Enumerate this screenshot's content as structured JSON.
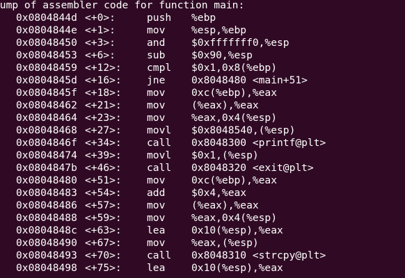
{
  "terminal": {
    "background": "#300a24",
    "foreground": "#ffffff",
    "header": "Dump of assembler code for function main:",
    "lines": [
      {
        "addr": "0x0804844d",
        "off": "<+0>:",
        "mn": "push",
        "ops": "%ebp"
      },
      {
        "addr": "0x0804844e",
        "off": "<+1>:",
        "mn": "mov",
        "ops": "%esp,%ebp"
      },
      {
        "addr": "0x08048450",
        "off": "<+3>:",
        "mn": "and",
        "ops": "$0xfffffff0,%esp"
      },
      {
        "addr": "0x08048453",
        "off": "<+6>:",
        "mn": "sub",
        "ops": "$0x90,%esp"
      },
      {
        "addr": "0x08048459",
        "off": "<+12>:",
        "mn": "cmpl",
        "ops": "$0x1,0x8(%ebp)"
      },
      {
        "addr": "0x0804845d",
        "off": "<+16>:",
        "mn": "jne",
        "ops": "0x8048480 <main+51>"
      },
      {
        "addr": "0x0804845f",
        "off": "<+18>:",
        "mn": "mov",
        "ops": "0xc(%ebp),%eax"
      },
      {
        "addr": "0x08048462",
        "off": "<+21>:",
        "mn": "mov",
        "ops": "(%eax),%eax"
      },
      {
        "addr": "0x08048464",
        "off": "<+23>:",
        "mn": "mov",
        "ops": "%eax,0x4(%esp)"
      },
      {
        "addr": "0x08048468",
        "off": "<+27>:",
        "mn": "movl",
        "ops": "$0x8048540,(%esp)"
      },
      {
        "addr": "0x0804846f",
        "off": "<+34>:",
        "mn": "call",
        "ops": "0x8048300 <printf@plt>"
      },
      {
        "addr": "0x08048474",
        "off": "<+39>:",
        "mn": "movl",
        "ops": "$0x1,(%esp)"
      },
      {
        "addr": "0x0804847b",
        "off": "<+46>:",
        "mn": "call",
        "ops": "0x8048320 <exit@plt>"
      },
      {
        "addr": "0x08048480",
        "off": "<+51>:",
        "mn": "mov",
        "ops": "0xc(%ebp),%eax"
      },
      {
        "addr": "0x08048483",
        "off": "<+54>:",
        "mn": "add",
        "ops": "$0x4,%eax"
      },
      {
        "addr": "0x08048486",
        "off": "<+57>:",
        "mn": "mov",
        "ops": "(%eax),%eax"
      },
      {
        "addr": "0x08048488",
        "off": "<+59>:",
        "mn": "mov",
        "ops": "%eax,0x4(%esp)"
      },
      {
        "addr": "0x0804848c",
        "off": "<+63>:",
        "mn": "lea",
        "ops": "0x10(%esp),%eax"
      },
      {
        "addr": "0x08048490",
        "off": "<+67>:",
        "mn": "mov",
        "ops": "%eax,(%esp)"
      },
      {
        "addr": "0x08048493",
        "off": "<+70>:",
        "mn": "call",
        "ops": "0x8048310 <strcpy@plt>"
      },
      {
        "addr": "0x08048498",
        "off": "<+75>:",
        "mn": "lea",
        "ops": "0x10(%esp),%eax"
      }
    ]
  }
}
